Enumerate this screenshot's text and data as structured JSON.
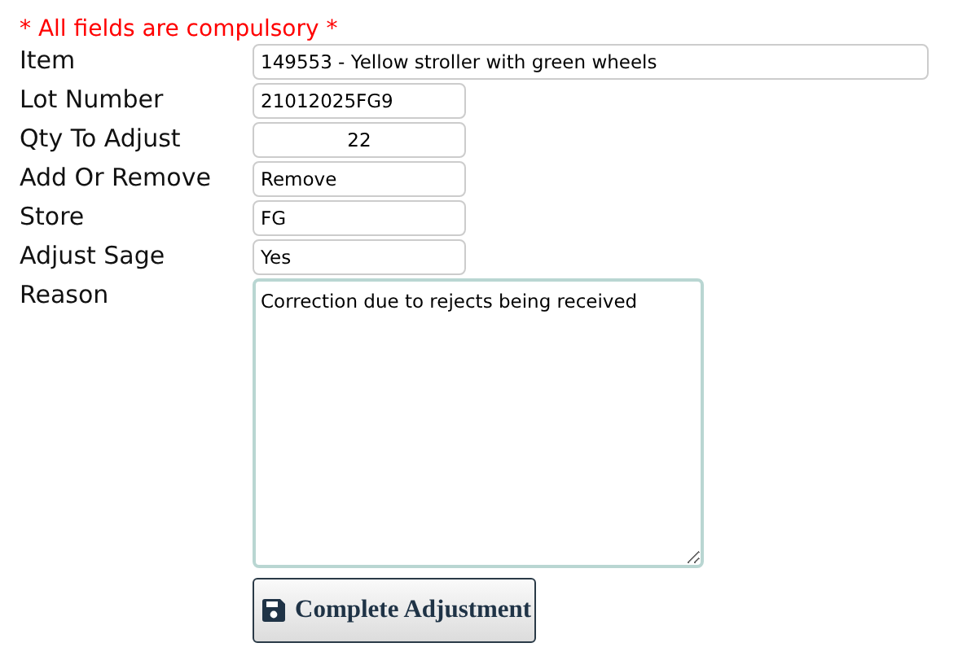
{
  "notice": "* All fields are compulsory *",
  "fields": [
    {
      "label": "Item",
      "kind": "wide",
      "value": "149553 - Yellow stroller with green wheels"
    },
    {
      "label": "Lot Number",
      "kind": "short",
      "value": "21012025FG9"
    },
    {
      "label": "Qty To Adjust",
      "kind": "centered",
      "value": "22"
    },
    {
      "label": "Add Or Remove",
      "kind": "short",
      "value": "Remove"
    },
    {
      "label": "Store",
      "kind": "short",
      "value": "FG"
    },
    {
      "label": "Adjust Sage",
      "kind": "short",
      "value": "Yes"
    },
    {
      "label": "Reason",
      "kind": "textarea",
      "value": "Correction due to rejects being received"
    }
  ],
  "button": {
    "label": "Complete Adjustment"
  }
}
